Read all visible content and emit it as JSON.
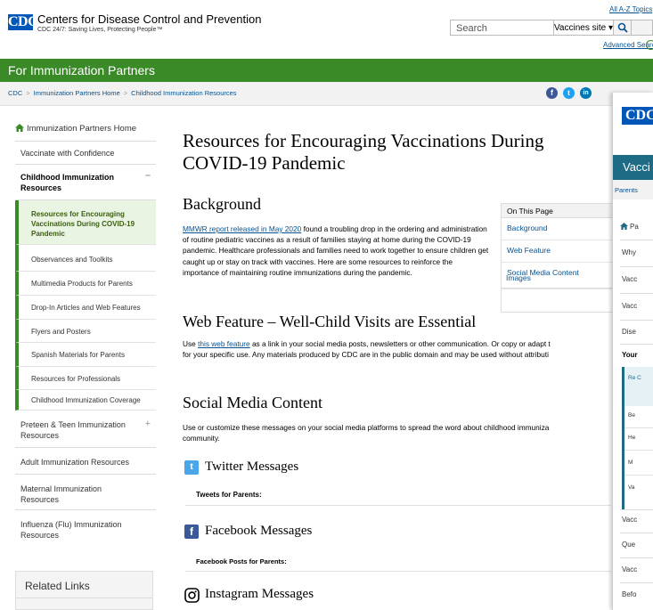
{
  "header": {
    "org_name": "Centers for Disease Control and Prevention",
    "tagline": "CDC 24/7: Saving Lives, Protecting People™",
    "logo_text": "CDC",
    "az_link": "All A-Z Topics",
    "search_placeholder": "Search",
    "search_scope": "Vaccines site ▾",
    "advanced_search": "Advanced Search"
  },
  "site_title": "For Immunization Partners",
  "breadcrumb": [
    "CDC",
    "Immunization Partners Home",
    "Childhood Immunization Resources"
  ],
  "leftnav": {
    "home": "Immunization Partners Home",
    "items": [
      "Vaccinate with Confidence",
      "Childhood Immunization Resources",
      "Resources for Encouraging Vaccinations During COVID-19 Pandemic",
      "Observances and Toolkits",
      "Multimedia Products for Parents",
      "Drop-In Articles and Web Features",
      "Flyers and Posters",
      "Spanish Materials for Parents",
      "Resources for Professionals",
      "Childhood Immunization Coverage",
      "Preteen & Teen Immunization Resources",
      "Adult Immunization Resources",
      "Maternal Immunization Resources",
      "Influenza (Flu) Immunization Resources"
    ],
    "related_links": "Related Links"
  },
  "main": {
    "title": "Resources for Encouraging Vaccinations During COVID-19 Pandemic",
    "background_heading": "Background",
    "background_link": "MMWR report released in May 2020",
    "background_text": " found a troubling drop in the ordering and administration of routine pediatric vaccines as a result of families staying at home during the COVID-19 pandemic. Healthcare professionals and families need to work together to ensure children get caught up or stay on track with vaccines. Here are some resources to reinforce the importance of maintaining routine immunizations during the pandemic.",
    "web_heading": "Web Feature – Well-Child Visits are Essential",
    "web_pre": "Use ",
    "web_link": "this web feature",
    "web_text": " as a link in your social media posts, newsletters or other communication. Or copy or adapt t",
    "web_text2": "for your specific use. Any materials produced by CDC are in the public domain and may be used without attributi",
    "social_heading": "Social Media Content",
    "social_text": "Use or customize these messages on your social media platforms to spread the word about childhood immuniza",
    "social_text2": "community.",
    "twitter_heading": "Twitter Messages",
    "twitter_sub": "Tweets for Parents:",
    "facebook_heading": "Facebook Messages",
    "facebook_sub": "Facebook Posts for Parents:",
    "instagram_heading": "Instagram Messages"
  },
  "on_this_page": {
    "heading": "On This Page",
    "items": [
      "Background",
      "Web Feature",
      "Social Media Content",
      "Images"
    ]
  },
  "popup": {
    "logo": "CDC",
    "bar": "Vacci",
    "crumb": "Parents",
    "items": [
      "Pa",
      "Why",
      "Vacc",
      "Vacc",
      "Dise",
      "Your",
      "Re C",
      "Be",
      "He",
      "M",
      "Va",
      "Vacc",
      "Que",
      "Vacc",
      "Befo"
    ]
  },
  "colors": {
    "green": "#3b8a28",
    "cdc_blue": "#0057b8",
    "link": "#075290",
    "facebook": "#3b5998",
    "twitter": "#1da1f2",
    "linkedin": "#0077b5"
  }
}
